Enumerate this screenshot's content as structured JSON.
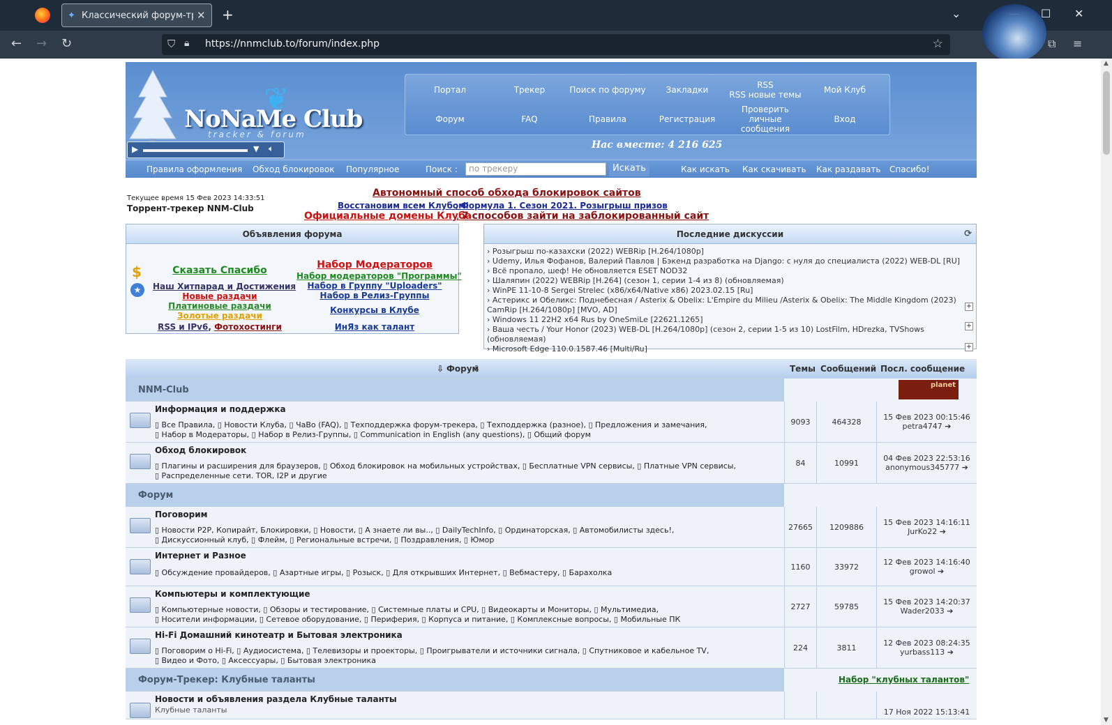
{
  "browser": {
    "tab_title": "Классический форум-трекер",
    "tab_close": "✕",
    "new_tab": "+",
    "url": "https://nnmclub.to/forum/index.php",
    "win_min": "—",
    "win_max": "☐",
    "win_close": "✕",
    "tab_list": "⌄"
  },
  "header": {
    "logo_text": "NoNaMe Club",
    "logo_sub": "tracker & forum",
    "together": "Нас вместе: 4 216 625",
    "nav_top": [
      "Портал",
      "Трекер",
      "Поиск по форуму",
      "Закладки",
      "RSS\nRSS новые темы",
      "Мой Клуб"
    ],
    "nav_bottom": [
      "Форум",
      "FAQ",
      "Правила",
      "Регистрация",
      "Проверить личные сообщения",
      "Вход"
    ],
    "subnav_left": [
      "Правила оформления",
      "Обход блокировок",
      "Популярное"
    ],
    "search_label": "Поиск :",
    "search_placeholder": "по трекеру",
    "search_button": "Искать",
    "subnav_right": [
      "Как искать",
      "Как скачивать",
      "Как раздавать",
      "Спасибо!"
    ]
  },
  "announce": {
    "current_time": "Текущее время 15 Фев 2023 14:33:51",
    "tracker_name": "Торрент-трекер NNM-Club",
    "line1": "Автономный способ обхода блокировок сайтов",
    "line2a": "Восстановим всем Клубом!",
    "line2b": "Формула 1. Сезон 2021. Розыгрыш призов",
    "line3a": "Официальные домены Клуба",
    "line3b": "7 способов зайти на заблокированный сайт"
  },
  "ann_panel": {
    "title": "Объявления форума",
    "left": [
      {
        "text": "Сказать Спасибо",
        "color": "#1f8a1f",
        "size": "14px"
      },
      {
        "text": "Наш Хитпарад и Достижения",
        "color": "#333366"
      },
      {
        "text": "Новые раздачи",
        "color": "#cc1111"
      },
      {
        "text": "Платиновые раздачи",
        "color": "#2a8a2a"
      },
      {
        "text": "Золотые раздачи",
        "color": "#e0a000"
      }
    ],
    "rss": "RSS и IPv6",
    "photo": "Фотохостинги",
    "right": [
      {
        "text": "Набор Модераторов",
        "color": "#cc1111",
        "size": "14px"
      },
      {
        "text": "Набор модераторов \"Программы\"",
        "color": "#1f8a1f"
      },
      {
        "text": "Набор в Группу \"Uploaders\"",
        "color": "#1a3a9a"
      },
      {
        "text": "Набор в Релиз-Группы",
        "color": "#1a3a9a"
      },
      {
        "text": "Конкурсы в Клубе",
        "color": "#1a3a9a"
      },
      {
        "text": "ИнЯз как талант",
        "color": "#1a3a9a"
      }
    ],
    "icon_dollar": "$",
    "icon_star": "★"
  },
  "disc_panel": {
    "title": "Последние дискуссии",
    "items": [
      "› Розыгрыш по-казахски (2022) WEBRip [H.264/1080p]",
      "› Udemy, Илья Фофанов, Валерий Павлов | Бэкенд разработка на Django: с нуля до специалиста (2022) WEB-DL [RU]",
      "› Всё пропало, шеф! Не обновляется ESET NOD32",
      "› Шаляпин (2022) WEBRip [H.264] (сезон 1, серии 1-4 из 8) (обновляемая)",
      "› WinPE 11-10-8 Sergei Strelec (x86/x64/Native x86) 2023.02.15 [Ru]",
      "› Астерикс и Обеликс: Поднебесная / Asterix & Obelix: L'Empire du Milieu /Asterix & Obelix: The Middle Kingdom (2023)",
      "  CamRip [H.264/1080p] [MVO, AD]",
      "› Windows 11 22H2 x64 Rus by OneSmiLe [22621.1265]",
      "› Ваша честь / Your Honor (2023) WEB-DL [H.264/1080p] (сезон 2, серии 1-5 из 10) LostFilm, HDrezka, TVShows",
      "  (обновляемая)",
      "› Microsoft Edge 110.0.1587.46 [Multi/Ru]"
    ],
    "plus": "+",
    "refresh": "⟳"
  },
  "forum": {
    "head_forum": "Форум",
    "head_topics": "Темы",
    "head_posts": "Сообщений",
    "head_last": "Посл. сообщение",
    "cat1": "NNM-Club",
    "cat1_badge": "planet",
    "rows1": [
      {
        "title": "Информация и поддержка",
        "l1": "▯ Все Правила, ▯ Новости Клуба, ▯ ЧаВо (FAQ), ▯ Техподдержка форум-трекера, ▯ Техподдержка (разное), ▯ Предложения и замечания,",
        "l2": "▯ Набор в Модераторы, ▯ Набор в Релиз-Группы, ▯ Communication in English (any questions), ▯ Общий форум",
        "topics": "9093",
        "posts": "464328",
        "last_date": "15 Фев 2023 00:15:46",
        "last_user": "petra4747 ➔"
      },
      {
        "title": "Обход блокировок",
        "l1": "▯ Плагины и расширения для браузеров, ▯ Обход блокировок на мобильных устройствах, ▯ Бесплатные VPN сервисы, ▯ Платные VPN сервисы,",
        "l2": "▯ Распределенные сети. TOR, I2P и другие",
        "topics": "84",
        "posts": "10991",
        "last_date": "04 Фев 2023 22:53:16",
        "last_user": "anonymous345777 ➔"
      }
    ],
    "cat2": "Форум",
    "rows2": [
      {
        "title": "Поговорим",
        "l1": "▯ Новости P2P, Копирайт, Блокировки, ▯ Новости, ▯ А знаете ли вы.., ▯ DailyTechInfo, ▯ Ординаторская, ▯ Автомобилисты здесь!,",
        "l2": "▯ Дискуссионный клуб, ▯ Флейм, ▯ Региональные встречи, ▯ Поздравления, ▯ Юмор",
        "topics": "27665",
        "posts": "1209886",
        "last_date": "15 Фев 2023 14:16:11",
        "last_user": "JurKo22 ➔"
      },
      {
        "title": "Интернет и Разное",
        "l1": "▯ Обсуждение провайдеров, ▯ Азартные игры, ▯ Розыск, ▯ Для открывших Интернет, ▯ Вебмастеру, ▯ Барахолка",
        "l2": "",
        "topics": "1160",
        "posts": "33972",
        "last_date": "12 Фев 2023 14:16:40",
        "last_user": "growol ➔"
      },
      {
        "title": "Компьютеры и комплектующие",
        "l1": "▯ Компьютерные новости, ▯ Обзоры и тестирование, ▯ Системные платы и CPU, ▯ Видеокарты и Мониторы, ▯ Мультимедиа,",
        "l2": "▯ Носители информации, ▯ Сетевое оборудование, ▯ Периферия, ▯ Корпуса и питание, ▯ Комплексные вопросы, ▯ Мобильные ПК",
        "topics": "2727",
        "posts": "59785",
        "last_date": "15 Фев 2023 14:20:37",
        "last_user": "Wader2033 ➔"
      },
      {
        "title": "Hi-Fi Домашний кинотеатр и Бытовая электроника",
        "l1": "▯ Поговорим о Hi-Fi, ▯ Аудиосистема, ▯ Телевизоры и проекторы, ▯ Проигрыватели и источники сигнала, ▯ Спутниковое и кабельное TV,",
        "l2": "▯ Видео и Фото, ▯ Аксессуары, ▯ Бытовая электроника",
        "topics": "224",
        "posts": "3811",
        "last_date": "12 Фев 2023 08:24:35",
        "last_user": "yurbass113 ➔"
      }
    ],
    "cat3": "Форум-Трекер: Клубные таланты",
    "cat3_link": "Набор \"клубных талантов\"",
    "row3_title": "Новости и объявления раздела Клубные таланты",
    "row3_sub": "Клубные таланты",
    "row3_date": "17 Ноя 2022 15:13:41"
  }
}
